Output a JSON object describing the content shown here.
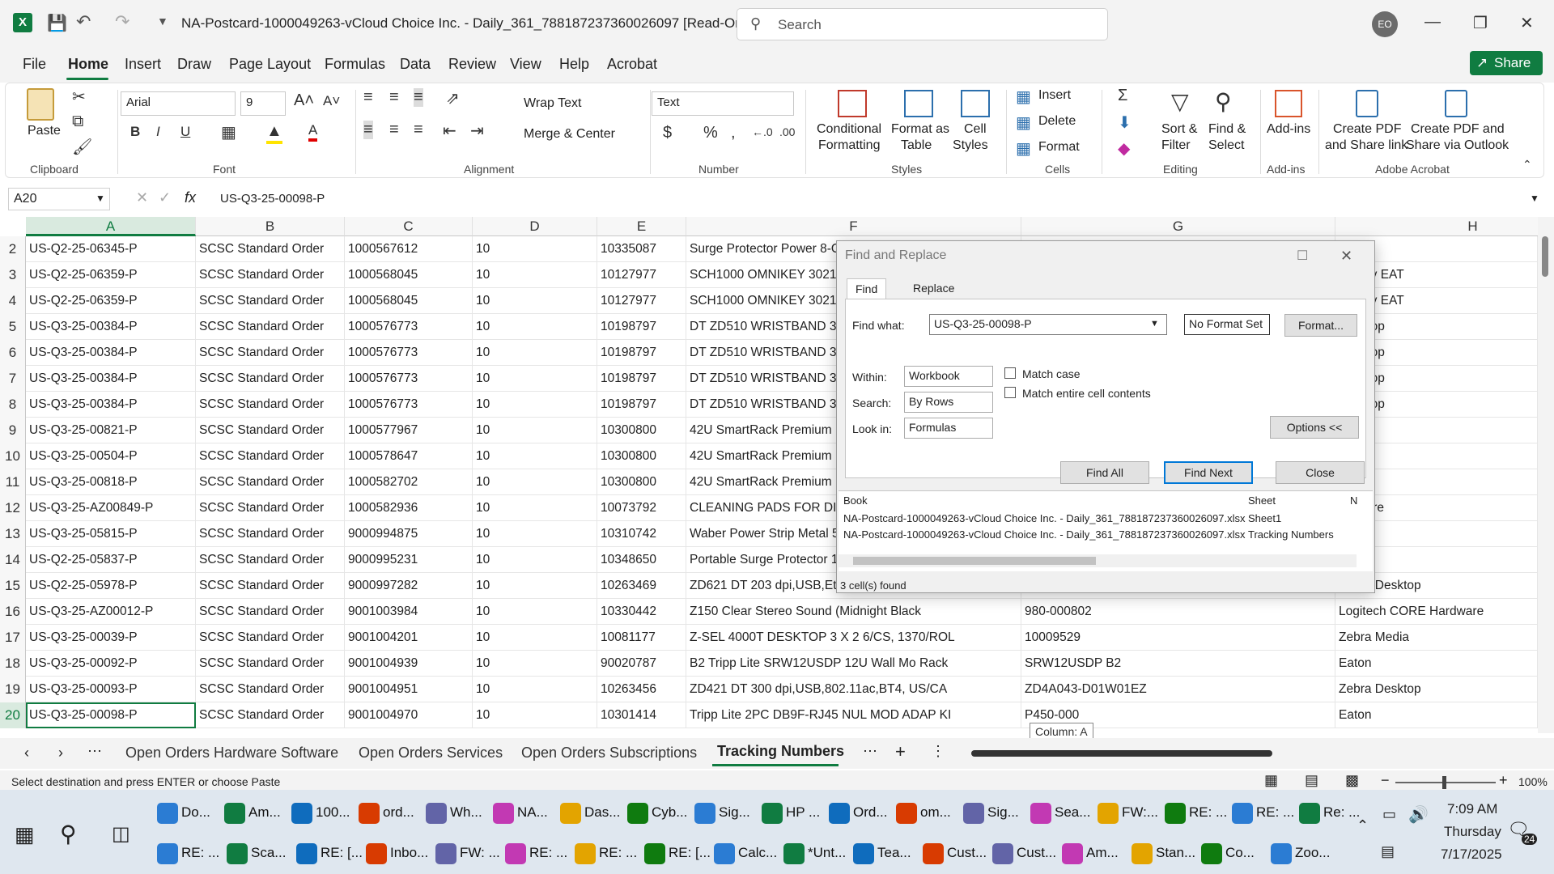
{
  "titlebar": {
    "title": "NA-Postcard-1000049263-vCloud Choice Inc. - Daily_361_788187237360026097  [Read-Only]  - E...",
    "search_placeholder": "Search",
    "avatar_initials": "EO"
  },
  "menu": [
    "File",
    "Home",
    "Insert",
    "Draw",
    "Page Layout",
    "Formulas",
    "Data",
    "Review",
    "View",
    "Help",
    "Acrobat"
  ],
  "share_label": "Share",
  "ribbon": {
    "clipboard": {
      "paste": "Paste",
      "label": "Clipboard"
    },
    "font": {
      "name": "Arial",
      "size": "9",
      "label": "Font"
    },
    "alignment": {
      "wrap": "Wrap Text",
      "merge": "Merge & Center",
      "label": "Alignment"
    },
    "number": {
      "format": "Text",
      "label": "Number"
    },
    "styles": {
      "cond": "Conditional",
      "cond2": "Formatting",
      "fmt_table": "Format as",
      "fmt_table2": "Table",
      "cell_styles": "Cell",
      "cell_styles2": "Styles",
      "label": "Styles"
    },
    "cells": {
      "insert": "Insert",
      "delete": "Delete",
      "format": "Format",
      "label": "Cells"
    },
    "editing": {
      "sort": "Sort &",
      "sort2": "Filter",
      "find": "Find &",
      "find2": "Select",
      "label": "Editing"
    },
    "addins": {
      "addins": "Add-ins",
      "label": "Add-ins"
    },
    "acrobat": {
      "pdf1": "Create PDF",
      "pdf1b": "and Share link",
      "pdf2": "Create PDF and",
      "pdf2b": "Share via Outlook",
      "label": "Adobe Acrobat"
    }
  },
  "formula_bar": {
    "name_box": "A20",
    "fx": "fx",
    "value": "US-Q3-25-00098-P"
  },
  "columns": [
    "A",
    "B",
    "C",
    "D",
    "E",
    "F",
    "G",
    "H"
  ],
  "rows": [
    {
      "n": "2",
      "a": "US-Q2-25-06345-P",
      "b": "SCSC Standard Order",
      "c": "1000567612",
      "d": "10",
      "e": "10335087",
      "f": "Surge Protector Power 8-Ou",
      "g": "",
      "h": ""
    },
    {
      "n": "3",
      "a": "US-Q2-25-06359-P",
      "b": "SCSC Standard Order",
      "c": "1000568045",
      "d": "10",
      "e": "10127977",
      "f": "SCH1000 OMNIKEY 3021 U",
      "g": "",
      "h": "nniKey EAT"
    },
    {
      "n": "4",
      "a": "US-Q2-25-06359-P",
      "b": "SCSC Standard Order",
      "c": "1000568045",
      "d": "10",
      "e": "10127977",
      "f": "SCH1000 OMNIKEY 3021 U",
      "g": "",
      "h": "nniKey EAT"
    },
    {
      "n": "5",
      "a": "US-Q3-25-00384-P",
      "b": "SCSC Standard Order",
      "c": "1000576773",
      "d": "10",
      "e": "10198797",
      "f": "DT ZD510 WRISTBAND 300",
      "g": "",
      "h": "Desktop"
    },
    {
      "n": "6",
      "a": "US-Q3-25-00384-P",
      "b": "SCSC Standard Order",
      "c": "1000576773",
      "d": "10",
      "e": "10198797",
      "f": "DT ZD510 WRISTBAND 300",
      "g": "",
      "h": "Desktop"
    },
    {
      "n": "7",
      "a": "US-Q3-25-00384-P",
      "b": "SCSC Standard Order",
      "c": "1000576773",
      "d": "10",
      "e": "10198797",
      "f": "DT ZD510 WRISTBAND 300",
      "g": "",
      "h": "Desktop"
    },
    {
      "n": "8",
      "a": "US-Q3-25-00384-P",
      "b": "SCSC Standard Order",
      "c": "1000576773",
      "d": "10",
      "e": "10198797",
      "f": "DT ZD510 WRISTBAND 300",
      "g": "",
      "h": "Desktop"
    },
    {
      "n": "9",
      "a": "US-Q3-25-00821-P",
      "b": "SCSC Standard Order",
      "c": "1000577967",
      "d": "10",
      "e": "10300800",
      "f": "42U SmartRack Premium R",
      "g": "",
      "h": ""
    },
    {
      "n": "10",
      "a": "US-Q3-25-00504-P",
      "b": "SCSC Standard Order",
      "c": "1000578647",
      "d": "10",
      "e": "10300800",
      "f": "42U SmartRack Premium R",
      "g": "",
      "h": ""
    },
    {
      "n": "11",
      "a": "US-Q3-25-00818-P",
      "b": "SCSC Standard Order",
      "c": "1000582702",
      "d": "10",
      "e": "10300800",
      "f": "42U SmartRack Premium R",
      "g": "",
      "h": ""
    },
    {
      "n": "12",
      "a": "US-Q3-25-AZ00849-P",
      "b": "SCSC Standard Order",
      "c": "1000582936",
      "d": "10",
      "e": "10073792",
      "f": "CLEANING PADS FOR DIR",
      "g": "",
      "h": "ardware"
    },
    {
      "n": "13",
      "a": "US-Q3-25-05815-P",
      "b": "SCSC Standard Order",
      "c": "9000994875",
      "d": "10",
      "e": "10310742",
      "f": "Waber Power Strip Metal 5-",
      "g": "",
      "h": ""
    },
    {
      "n": "14",
      "a": "US-Q2-25-05837-P",
      "b": "SCSC Standard Order",
      "c": "9000995231",
      "d": "10",
      "e": "10348650",
      "f": "Portable Surge Protector 1 C",
      "g": "",
      "h": ""
    },
    {
      "n": "15",
      "a": "US-Q2-25-05978-P",
      "b": "SCSC Standard Order",
      "c": "9000997282",
      "d": "10",
      "e": "10263469",
      "f": "ZD621 DT 203 dpi,USB,Eth,Serial,BTLE",
      "g": "ZD6A042-D01W01EZ",
      "h": "Zebra Desktop"
    },
    {
      "n": "16",
      "a": "US-Q3-25-AZ00012-P",
      "b": "SCSC Standard Order",
      "c": "9001003984",
      "d": "10",
      "e": "10330442",
      "f": "Z150 Clear Stereo Sound  (Midnight Black",
      "g": "980-000802",
      "h": "Logitech CORE Hardware"
    },
    {
      "n": "17",
      "a": "US-Q3-25-00039-P",
      "b": "SCSC Standard Order",
      "c": "9001004201",
      "d": "10",
      "e": "10081177",
      "f": "Z-SEL 4000T DESKTOP 3 X 2 6/CS, 1370/ROL",
      "g": "10009529",
      "h": "Zebra Media"
    },
    {
      "n": "18",
      "a": "US-Q3-25-00092-P",
      "b": "SCSC Standard Order",
      "c": "9001004939",
      "d": "10",
      "e": "90020787",
      "f": "B2 Tripp Lite SRW12USDP 12U Wall Mo Rack",
      "g": "SRW12USDP B2",
      "h": "Eaton"
    },
    {
      "n": "19",
      "a": "US-Q3-25-00093-P",
      "b": "SCSC Standard Order",
      "c": "9001004951",
      "d": "10",
      "e": "10263456",
      "f": "ZD421 DT 300 dpi,USB,802.11ac,BT4, US/CA",
      "g": "ZD4A043-D01W01EZ",
      "h": "Zebra Desktop"
    },
    {
      "n": "20",
      "a": "US-Q3-25-00098-P",
      "b": "SCSC Standard Order",
      "c": "9001004970",
      "d": "10",
      "e": "10301414",
      "f": "Tripp Lite 2PC DB9F-RJ45 NUL MOD ADAP KI",
      "g": "P450-000",
      "h": "Eaton"
    }
  ],
  "tooltip": "Column: A",
  "dialog": {
    "title": "Find and Replace",
    "tab_find": "Find",
    "tab_replace": "Replace",
    "find_what_label": "Find what:",
    "find_what_value": "US-Q3-25-00098-P",
    "no_format": "No Format Set",
    "format_btn": "Format...",
    "within_label": "Within:",
    "within_value": "Workbook",
    "search_label": "Search:",
    "search_value": "By Rows",
    "lookin_label": "Look in:",
    "lookin_value": "Formulas",
    "match_case": "Match case",
    "match_entire": "Match entire cell contents",
    "options_btn": "Options <<",
    "find_all": "Find All",
    "find_next": "Find Next",
    "close": "Close",
    "results_headers": [
      "Book",
      "Sheet",
      "N"
    ],
    "results": [
      {
        "book": "NA-Postcard-1000049263-vCloud Choice Inc. - Daily_361_788187237360026097.xlsx",
        "sheet": "Sheet1"
      },
      {
        "book": "NA-Postcard-1000049263-vCloud Choice Inc. - Daily_361_788187237360026097.xlsx",
        "sheet": "Tracking Numbers"
      }
    ],
    "status": "3 cell(s) found"
  },
  "sheet_tabs": [
    "Open Orders Hardware Software",
    "Open Orders Services",
    "Open Orders Subscriptions",
    "Tracking Numbers"
  ],
  "status": {
    "message": "Select destination and press ENTER or choose Paste",
    "zoom": "100%"
  },
  "taskbar": {
    "row1": [
      "Do...",
      "Am...",
      "100...",
      "ord...",
      "Wh...",
      "NA...",
      "Das...",
      "Cyb...",
      "Sig...",
      "HP ...",
      "Ord...",
      "om...",
      "Sig...",
      "Sea...",
      "FW:...",
      "RE: ...",
      "RE: ...",
      "Re: ..."
    ],
    "row2": [
      "RE: ...",
      "Sca...",
      "RE: [...",
      "Inbo...",
      "FW: ...",
      "RE: ...",
      "RE: ...",
      "RE: [...",
      "Calc...",
      "*Unt...",
      "Tea...",
      "Cust...",
      "Cust...",
      "Am...",
      "Stan...",
      "Co...",
      "Zoo..."
    ],
    "time": "7:09 AM",
    "day": "Thursday",
    "date": "7/17/2025",
    "badge": "24"
  }
}
